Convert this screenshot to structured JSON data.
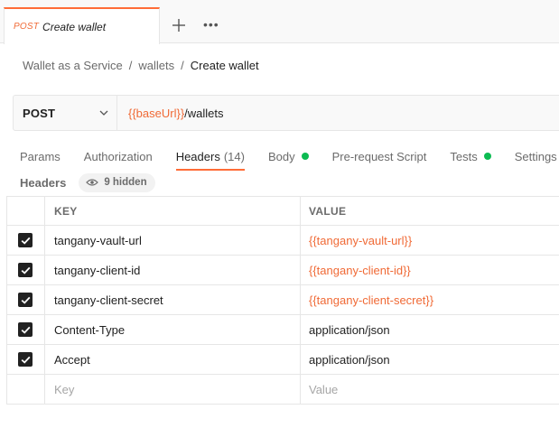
{
  "tab": {
    "method": "POST",
    "title": "Create wallet"
  },
  "tabbar": {
    "add_icon": "plus-icon",
    "more_icon": "ellipsis-icon",
    "more_label": "•••"
  },
  "breadcrumb": {
    "items": [
      "Wallet as a Service",
      "wallets"
    ],
    "separator": "/",
    "current": "Create wallet"
  },
  "request": {
    "method": "POST",
    "url_variable": "{{baseUrl}}",
    "url_path": "/wallets"
  },
  "subtabs": [
    {
      "label": "Params"
    },
    {
      "label": "Authorization"
    },
    {
      "label": "Headers",
      "count": "(14)"
    },
    {
      "label": "Body"
    },
    {
      "label": "Pre-request Script"
    },
    {
      "label": "Tests"
    },
    {
      "label": "Settings"
    }
  ],
  "headers_section": {
    "title": "Headers",
    "hidden_label": "9 hidden"
  },
  "table": {
    "columns": {
      "key": "KEY",
      "value": "VALUE"
    },
    "rows": [
      {
        "key": "tangany-vault-url",
        "value": "{{tangany-vault-url}}",
        "checked": true
      },
      {
        "key": "tangany-client-id",
        "value": "{{tangany-client-id}}",
        "checked": true
      },
      {
        "key": "tangany-client-secret",
        "value": "{{tangany-client-secret}}",
        "checked": true
      },
      {
        "key": "Content-Type",
        "value": "application/json",
        "checked": true
      },
      {
        "key": "Accept",
        "value": "application/json",
        "checked": true
      }
    ],
    "placeholders": {
      "key": "Key",
      "value": "Value"
    }
  },
  "colors": {
    "accent": "#ff6c37",
    "variable": "#f06a36",
    "status_dot": "#0cbb52"
  }
}
